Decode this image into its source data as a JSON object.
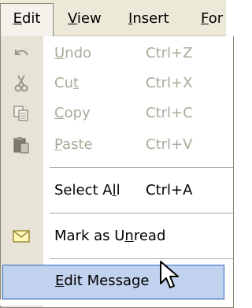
{
  "menubar": {
    "items": [
      {
        "label": "Edit",
        "mnemonic": "E",
        "rest": "dit"
      },
      {
        "label": "View",
        "mnemonic": "V",
        "rest": "iew"
      },
      {
        "label": "Insert",
        "mnemonic": "I",
        "rest": "nsert"
      },
      {
        "label": "For",
        "mnemonic": "F",
        "rest": "or"
      }
    ]
  },
  "menu": {
    "items": [
      {
        "pre": "",
        "mn": "U",
        "post": "ndo",
        "shortcut": "Ctrl+Z",
        "icon": "undo-icon",
        "enabled": false
      },
      {
        "pre": "Cu",
        "mn": "t",
        "post": "",
        "shortcut": "Ctrl+X",
        "icon": "cut-icon",
        "enabled": false
      },
      {
        "pre": "",
        "mn": "C",
        "post": "opy",
        "shortcut": "Ctrl+C",
        "icon": "copy-icon",
        "enabled": false
      },
      {
        "pre": "",
        "mn": "P",
        "post": "aste",
        "shortcut": "Ctrl+V",
        "icon": "paste-icon",
        "enabled": false
      },
      {
        "pre": "Select A",
        "mn": "l",
        "post": "l",
        "shortcut": "Ctrl+A",
        "icon": "",
        "enabled": true
      },
      {
        "pre": "Mark as U",
        "mn": "n",
        "post": "read",
        "shortcut": "",
        "icon": "envelope-icon",
        "enabled": true
      },
      {
        "pre": "",
        "mn": "E",
        "post": "dit Message",
        "shortcut": "",
        "icon": "",
        "enabled": true,
        "highlighted": true
      }
    ]
  },
  "colors": {
    "menubar_bg": "#ece9d8",
    "gutter_bg": "#e7e3d6",
    "disabled_text": "#aca899",
    "highlight_bg": "#c1d2ee",
    "highlight_border": "#316ac5"
  }
}
